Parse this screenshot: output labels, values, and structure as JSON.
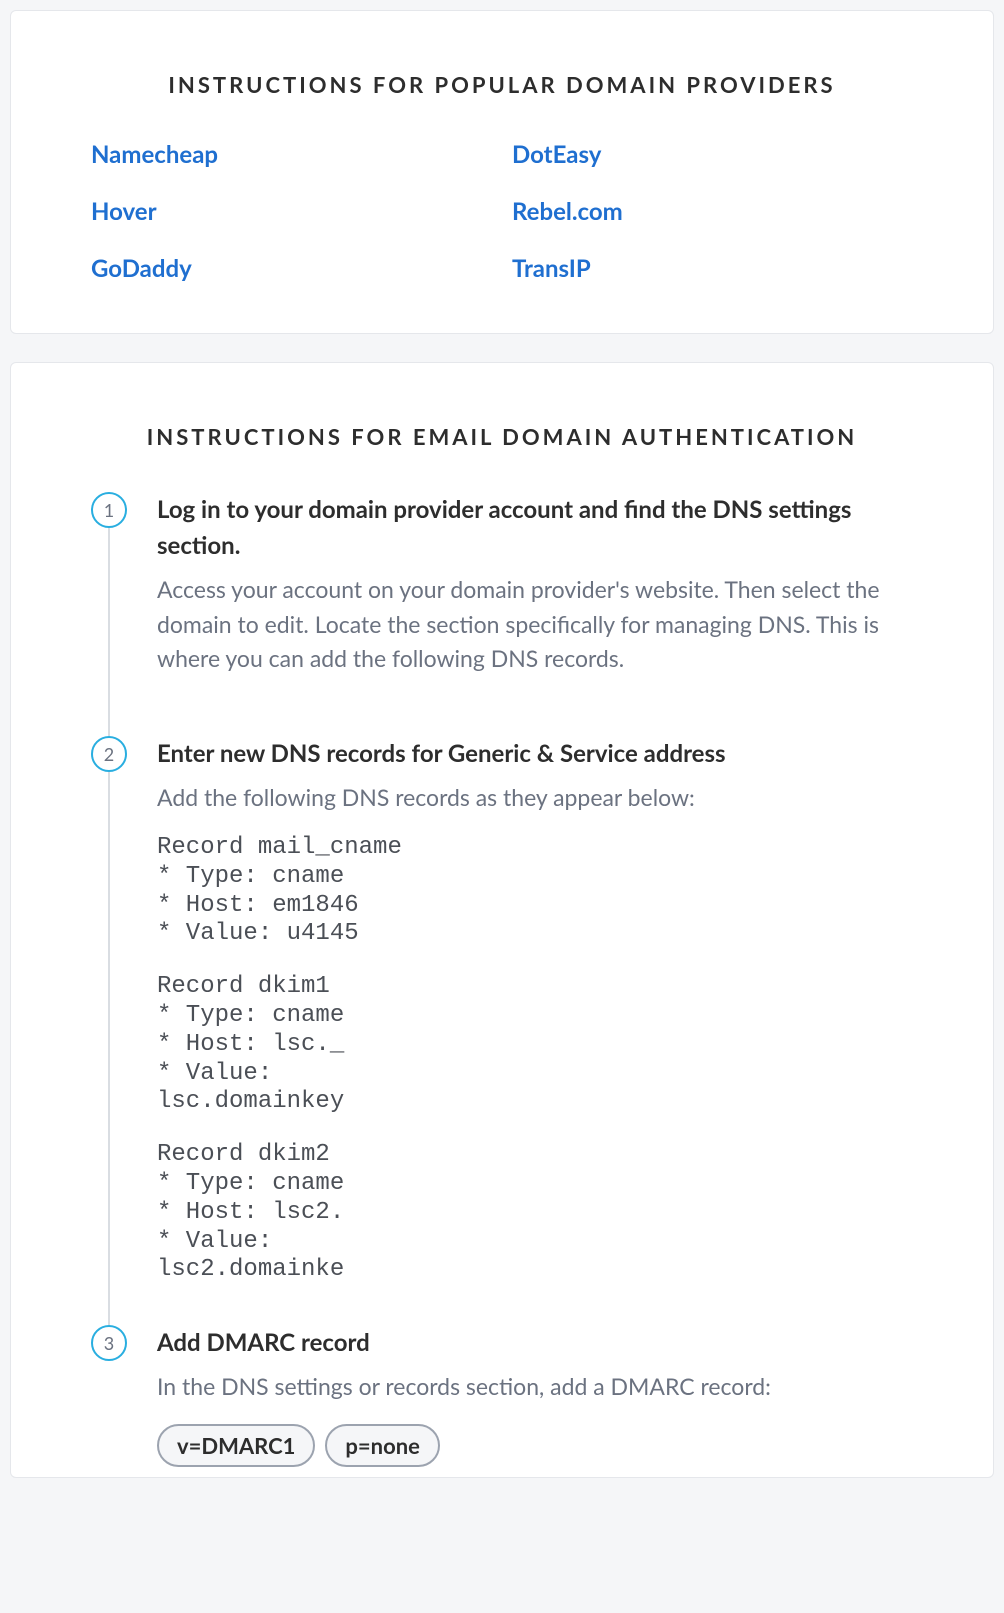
{
  "providers": {
    "title": "INSTRUCTIONS FOR POPULAR DOMAIN PROVIDERS",
    "items": [
      "Namecheap",
      "DotEasy",
      "Hover",
      "Rebel.com",
      "GoDaddy",
      "TransIP"
    ]
  },
  "auth": {
    "title": "INSTRUCTIONS FOR EMAIL DOMAIN AUTHENTICATION",
    "steps": [
      {
        "num": "1",
        "title": "Log in to your domain provider account and find the DNS settings section.",
        "desc": "Access your account on your domain provider's website. Then select the domain to edit. Locate the section specifically for managing DNS. This is where you can add the following DNS records."
      },
      {
        "num": "2",
        "title": "Enter new DNS records for Generic & Service address",
        "desc": "Add the following DNS records as they appear below:",
        "records": [
          "Record mail_cname\n* Type: cname\n* Host: em1846\n* Value: u4145",
          "Record dkim1\n* Type: cname\n* Host: lsc._\n* Value:\nlsc.domainkey",
          "Record dkim2\n* Type: cname\n* Host: lsc2.\n* Value:\nlsc2.domainke"
        ]
      },
      {
        "num": "3",
        "title": "Add DMARC record",
        "desc": "In the DNS settings or records section, add a DMARC record:",
        "chips": [
          "v=DMARC1",
          "p=none"
        ]
      }
    ]
  }
}
